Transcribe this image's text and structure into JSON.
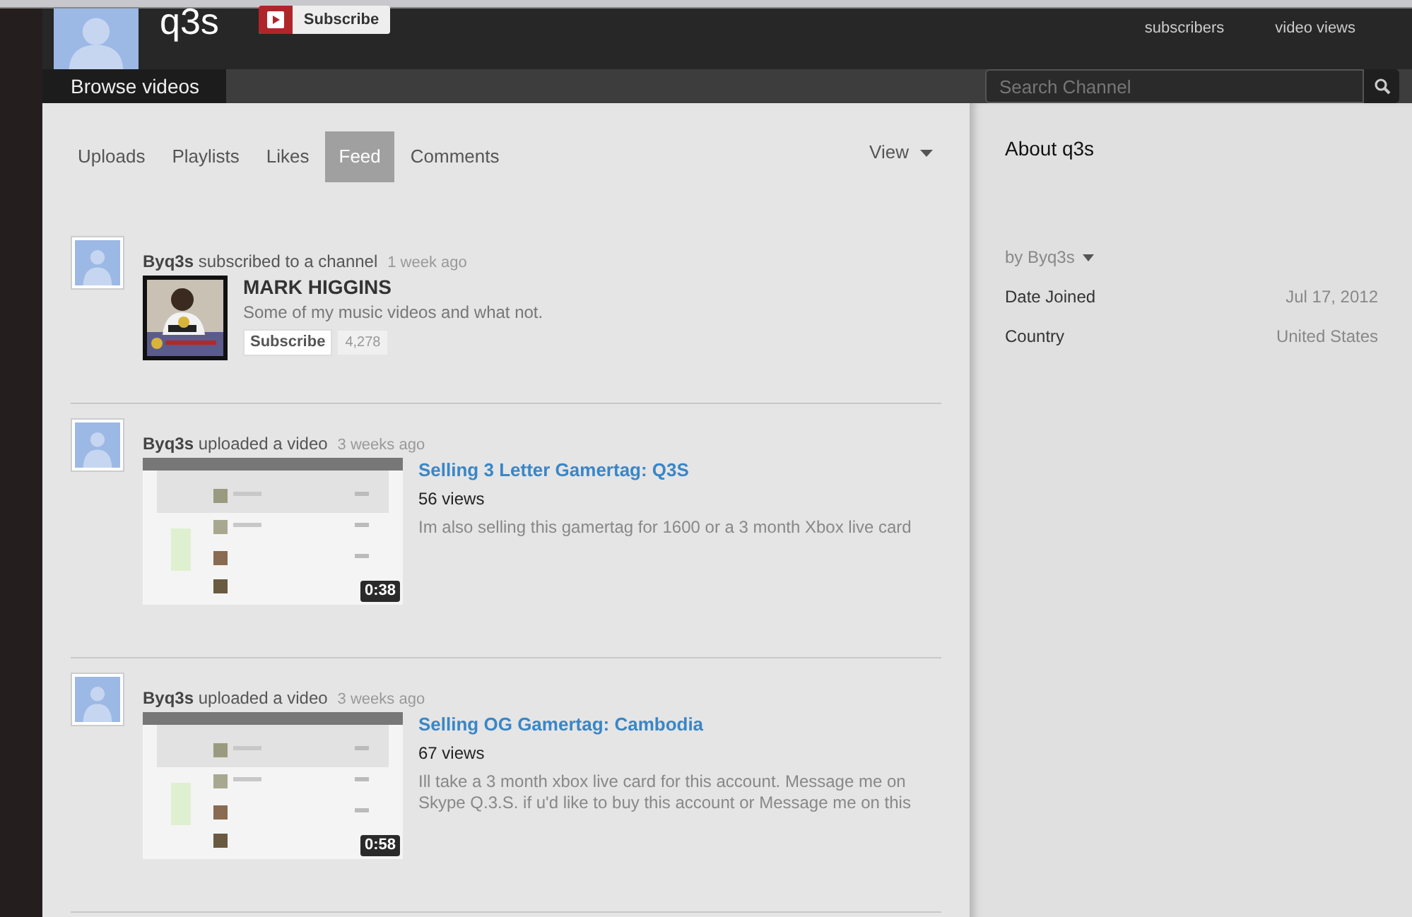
{
  "channel": {
    "name": "q3s",
    "subscribe_label": "Subscribe",
    "stats": [
      {
        "label": "subscribers"
      },
      {
        "label": "video views"
      }
    ]
  },
  "nav": {
    "tabs": [
      {
        "label": "Browse videos",
        "selected": true
      }
    ],
    "search": {
      "placeholder": "Search Channel"
    }
  },
  "feed_tabs": [
    {
      "label": "Uploads",
      "selected": false
    },
    {
      "label": "Playlists",
      "selected": false
    },
    {
      "label": "Likes",
      "selected": false
    },
    {
      "label": "Feed",
      "selected": true
    },
    {
      "label": "Comments",
      "selected": false
    }
  ],
  "view_menu": {
    "label": "View"
  },
  "feed": [
    {
      "kind": "subscription",
      "user": "Byq3s",
      "action": "subscribed to a channel",
      "time": "1 week ago",
      "channel": {
        "title": "MARK HIGGINS",
        "description": "Some of my music videos and what not.",
        "subscribe_label": "Subscribe",
        "subscriber_count": "4,278"
      }
    },
    {
      "kind": "upload",
      "user": "Byq3s",
      "action": "uploaded a video",
      "time": "3 weeks ago",
      "video": {
        "title": "Selling 3 Letter Gamertag: Q3S",
        "views": "56 views",
        "description": "Im also selling this gamertag for 1600 or a 3 month Xbox live card",
        "duration": "0:38"
      }
    },
    {
      "kind": "upload",
      "user": "Byq3s",
      "action": "uploaded a video",
      "time": "3 weeks ago",
      "video": {
        "title": "Selling OG Gamertag: Cambodia",
        "views": "67 views",
        "description": "Ill take a 3 month xbox live card for this account. Message me on Skype Q.3.S. if u'd like to buy this account or Message me on this",
        "duration": "0:58"
      }
    }
  ],
  "about": {
    "title": "About q3s",
    "author": "by Byq3s",
    "details": [
      {
        "label": "Date Joined",
        "value": "Jul 17, 2012"
      },
      {
        "label": "Country",
        "value": "United States"
      }
    ]
  }
}
